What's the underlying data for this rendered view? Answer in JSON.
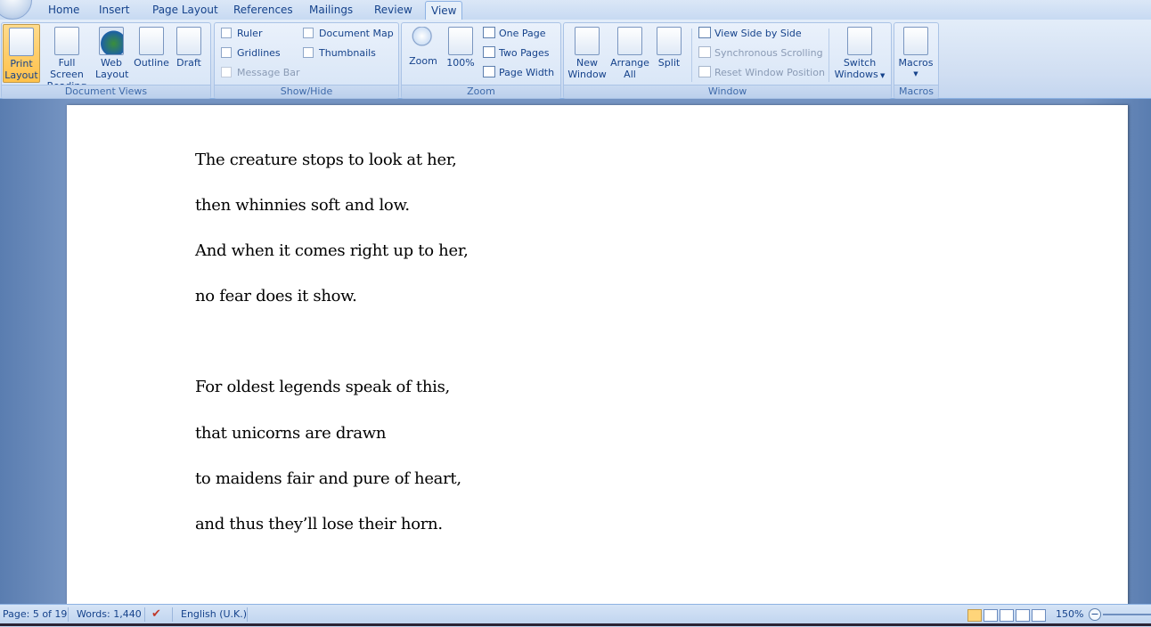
{
  "tabs": [
    "Home",
    "Insert",
    "Page Layout",
    "References",
    "Mailings",
    "Review",
    "View"
  ],
  "active_tab": "View",
  "groups": {
    "document_views": {
      "label": "Document Views",
      "buttons": [
        {
          "line1": "Print",
          "line2": "Layout",
          "active": true
        },
        {
          "line1": "Full Screen",
          "line2": "Reading"
        },
        {
          "line1": "Web",
          "line2": "Layout"
        },
        {
          "line1": "Outline",
          "line2": ""
        },
        {
          "line1": "Draft",
          "line2": ""
        }
      ]
    },
    "show_hide": {
      "label": "Show/Hide",
      "ruler": "Ruler",
      "gridlines": "Gridlines",
      "message_bar": "Message Bar",
      "document_map": "Document Map",
      "thumbnails": "Thumbnails"
    },
    "zoom": {
      "label": "Zoom",
      "zoom": "Zoom",
      "hundred": "100%",
      "one_page": "One Page",
      "two_pages": "Two Pages",
      "page_width": "Page Width"
    },
    "window": {
      "label": "Window",
      "new_window_1": "New",
      "new_window_2": "Window",
      "arrange_all_1": "Arrange",
      "arrange_all_2": "All",
      "split": "Split",
      "view_side": "View Side by Side",
      "sync_scroll": "Synchronous Scrolling",
      "reset_pos": "Reset Window Position",
      "switch_1": "Switch",
      "switch_2": "Windows"
    },
    "macros": {
      "label": "Macros",
      "macros": "Macros"
    }
  },
  "document": {
    "lines": [
      "The creature stops to look at her,",
      "then whinnies soft and low.",
      "And when it comes right up to her,",
      "no fear does it show.",
      "For oldest legends speak of this,",
      "that unicorns are drawn",
      "to maidens fair and pure of heart,",
      "and thus they’ll lose their horn."
    ]
  },
  "status": {
    "page": "Page: 5 of 19",
    "words": "Words: 1,440",
    "language": "English (U.K.)",
    "zoom": "150%"
  }
}
